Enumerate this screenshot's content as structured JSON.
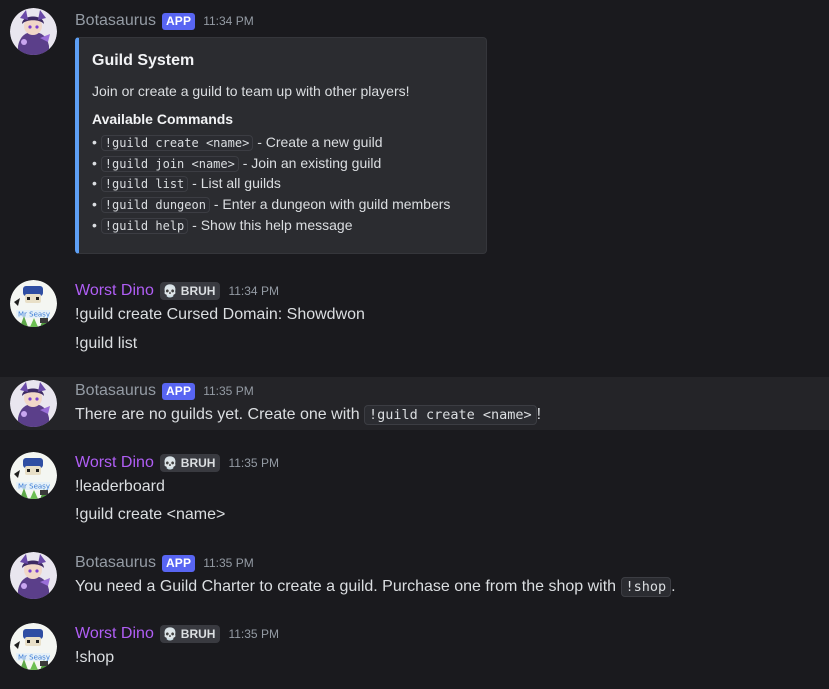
{
  "users": {
    "bot": {
      "name": "Botasaurus",
      "tag": "APP"
    },
    "dino": {
      "name": "Worst Dino",
      "tag": "BRUH",
      "tag_icon": "skull-icon"
    }
  },
  "messages": [
    {
      "author": "Botasaurus",
      "tag": "APP",
      "time": "11:34 PM",
      "embed": {
        "accent_color": "#5d9ff5",
        "title": "Guild System",
        "description": "Join or create a guild to team up with other players!",
        "field_name": "Available Commands",
        "items": [
          {
            "bullet": "•",
            "command": "!guild create <name>",
            "text": "- Create a new guild"
          },
          {
            "bullet": "•",
            "command": "!guild join <name>",
            "text": "- Join an existing guild"
          },
          {
            "bullet": "•",
            "command": "!guild list",
            "text": "- List all guilds"
          },
          {
            "bullet": "•",
            "command": "!guild dungeon",
            "text": "- Enter a dungeon with guild members"
          },
          {
            "bullet": "•",
            "command": "!guild help",
            "text": "- Show this help message"
          }
        ]
      }
    },
    {
      "author": "Worst Dino",
      "tag": "BRUH",
      "time": "11:34 PM",
      "lines": [
        "!guild create Cursed Domain: Showdwon",
        "!guild list"
      ]
    },
    {
      "author": "Botasaurus",
      "tag": "APP",
      "time": "11:35 PM",
      "text_before": "There are no guilds yet. Create one with ",
      "code": "!guild create <name>",
      "text_after": "!"
    },
    {
      "author": "Worst Dino",
      "tag": "BRUH",
      "time": "11:35 PM",
      "lines": [
        "!leaderboard",
        "!guild create <name>"
      ]
    },
    {
      "author": "Botasaurus",
      "tag": "APP",
      "time": "11:35 PM",
      "text_before": "You need a Guild Charter to create a guild. Purchase one from the shop with ",
      "code": "!shop",
      "text_after": "."
    },
    {
      "author": "Worst Dino",
      "tag": "BRUH",
      "time": "11:35 PM",
      "lines": [
        "!shop"
      ]
    }
  ],
  "colors": {
    "background": "#1a1a1e",
    "bot_name": "#949ba4",
    "dino_name": "#b05ef5",
    "app_tag": "#5865f2"
  }
}
